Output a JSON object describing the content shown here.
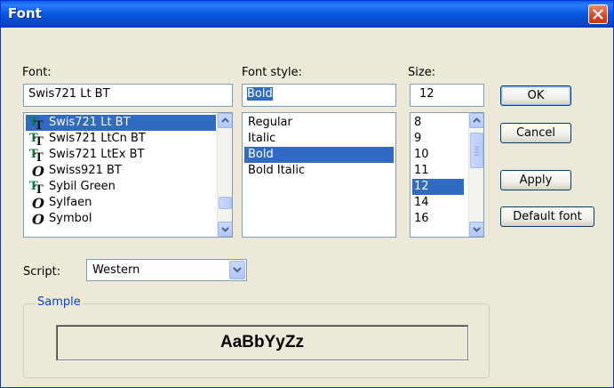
{
  "window": {
    "title": "Font"
  },
  "labels": {
    "font": "Font:",
    "style": "Font style:",
    "size": "Size:",
    "script": "Script:",
    "sample": "Sample"
  },
  "font": {
    "value": "Swis721 Lt BT",
    "items": [
      {
        "label": "Swis721 Lt BT",
        "icon": "truetype-icon",
        "selected": true
      },
      {
        "label": "Swis721 LtCn BT",
        "icon": "truetype-icon",
        "selected": false
      },
      {
        "label": "Swis721 LtEx BT",
        "icon": "truetype-icon",
        "selected": false
      },
      {
        "label": "Swiss921 BT",
        "icon": "opentype-icon",
        "selected": false
      },
      {
        "label": "Sybil Green",
        "icon": "truetype-icon",
        "selected": false
      },
      {
        "label": "Sylfaen",
        "icon": "opentype-icon",
        "selected": false
      },
      {
        "label": "Symbol",
        "icon": "opentype-icon",
        "selected": false
      }
    ]
  },
  "style": {
    "value": "Bold",
    "items": [
      {
        "label": "Regular",
        "selected": false
      },
      {
        "label": "Italic",
        "selected": false
      },
      {
        "label": "Bold",
        "selected": true
      },
      {
        "label": "Bold Italic",
        "selected": false
      }
    ]
  },
  "size": {
    "value": "12",
    "items": [
      {
        "label": "8",
        "selected": false
      },
      {
        "label": "9",
        "selected": false
      },
      {
        "label": "10",
        "selected": false
      },
      {
        "label": "11",
        "selected": false
      },
      {
        "label": "12",
        "selected": true
      },
      {
        "label": "14",
        "selected": false
      },
      {
        "label": "16",
        "selected": false
      }
    ]
  },
  "buttons": {
    "ok": "OK",
    "cancel": "Cancel",
    "apply": "Apply",
    "default_font": "Default font"
  },
  "script": {
    "value": "Western"
  },
  "sample": {
    "text": "AaBbYyZz"
  },
  "colors": {
    "selection": "#316ac5",
    "titlebar": "#0a5ae0",
    "group_title": "#0046d5",
    "close": "#d6472b"
  }
}
